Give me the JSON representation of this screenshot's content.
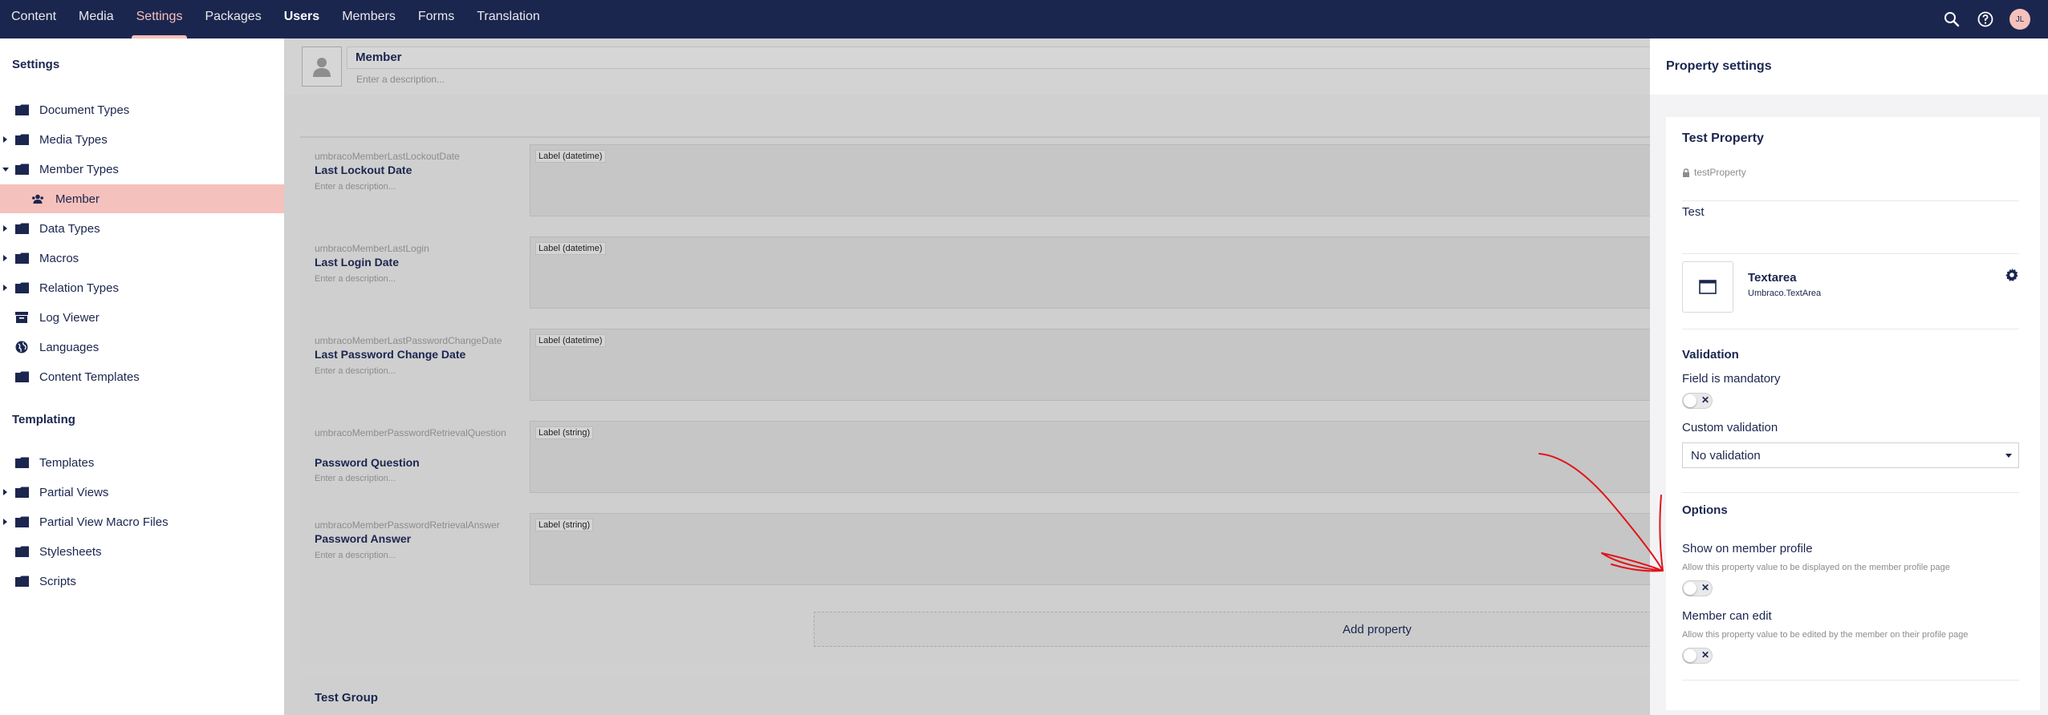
{
  "topnav": {
    "items": [
      "Content",
      "Media",
      "Settings",
      "Packages",
      "Users",
      "Members",
      "Forms",
      "Translation"
    ],
    "active": "Settings",
    "user_initials": "JL",
    "icons": [
      "search-icon",
      "help-icon"
    ]
  },
  "sidebar": {
    "settings_title": "Settings",
    "settings_items": [
      "Document Types",
      "Media Types",
      "Member Types",
      "Member",
      "Data Types",
      "Macros",
      "Relation Types",
      "Log Viewer",
      "Languages",
      "Content Templates"
    ],
    "templating_title": "Templating",
    "templating_items": [
      "Templates",
      "Partial Views",
      "Partial View Macro Files",
      "Stylesheets",
      "Scripts"
    ],
    "selected": "Member"
  },
  "main": {
    "member_name": "Member",
    "description_placeholder": "Enter a description...",
    "properties": [
      {
        "alias": "umbracoMemberLastLockoutDate",
        "name": "Last Lockout Date",
        "desc": "Enter a description...",
        "editor": "Label (datetime)"
      },
      {
        "alias": "umbracoMemberLastLogin",
        "name": "Last Login Date",
        "desc": "Enter a description...",
        "editor": "Label (datetime)"
      },
      {
        "alias": "umbracoMemberLastPasswordChangeDate",
        "name": "Last Password Change Date",
        "desc": "Enter a description...",
        "editor": "Label (datetime)"
      },
      {
        "alias": "umbracoMemberPasswordRetrievalQuestion",
        "name": "Password Question",
        "desc": "Enter a description...",
        "editor": "Label (string)"
      },
      {
        "alias": "umbracoMemberPasswordRetrievalAnswer",
        "name": "Password Answer",
        "desc": "Enter a description...",
        "editor": "Label (string)"
      }
    ],
    "add_property_label": "Add property",
    "test_group_label": "Test Group"
  },
  "panel": {
    "title": "Property settings",
    "property_name": "Test Property",
    "property_alias": "testProperty",
    "property_description": "Test",
    "editor_name": "Textarea",
    "editor_alias": "Umbraco.TextArea",
    "validation_heading": "Validation",
    "mandatory_label": "Field is mandatory",
    "custom_validation_label": "Custom validation",
    "custom_validation_value": "No validation",
    "options_heading": "Options",
    "show_on_profile_label": "Show on member profile",
    "show_on_profile_help": "Allow this property value to be displayed on the member profile page",
    "member_can_edit_label": "Member can edit",
    "member_can_edit_help": "Allow this property value to be edited by the member on their profile page",
    "toggle_off_glyph": "✕"
  },
  "colors": {
    "brand_navy": "#1b264f",
    "accent_pink": "#f5c1bc",
    "annotation_red": "#e0151b"
  }
}
